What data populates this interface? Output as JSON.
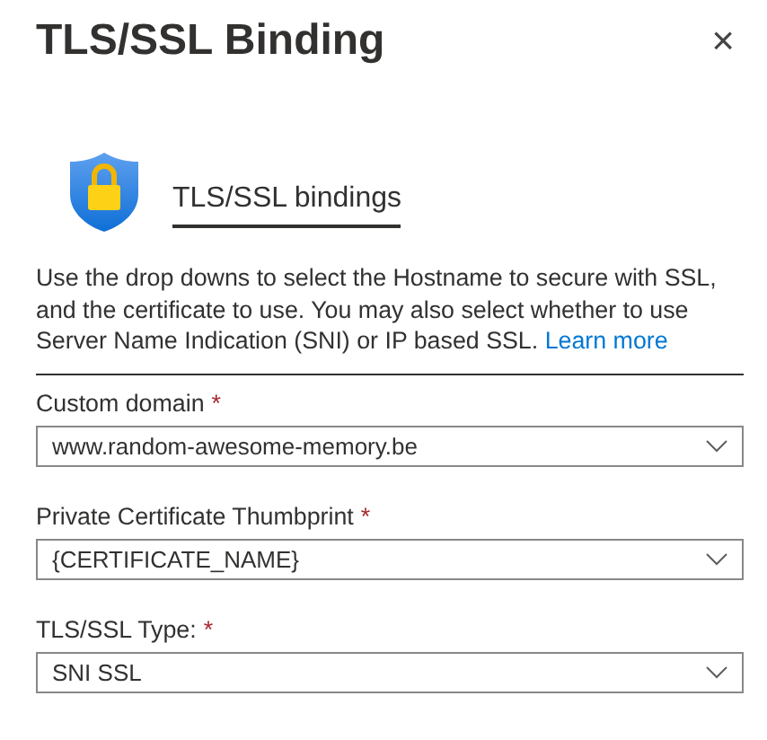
{
  "panel": {
    "title": "TLS/SSL Binding",
    "close": "×"
  },
  "section": {
    "heading": "TLS/SSL bindings",
    "description": "Use the drop downs to select the Hostname to secure with SSL, and the certificate to use. You may also select whether to use Server Name Indication (SNI) or IP based SSL.",
    "link": "Learn more"
  },
  "fields": [
    {
      "label": "Custom domain",
      "required_mark": "*",
      "value": "www.random-awesome-memory.be"
    },
    {
      "label": "Private Certificate Thumbprint",
      "required_mark": "*",
      "value": "{CERTIFICATE_NAME}"
    },
    {
      "label": "TLS/SSL Type:",
      "required_mark": "*",
      "value": "SNI SSL"
    }
  ]
}
